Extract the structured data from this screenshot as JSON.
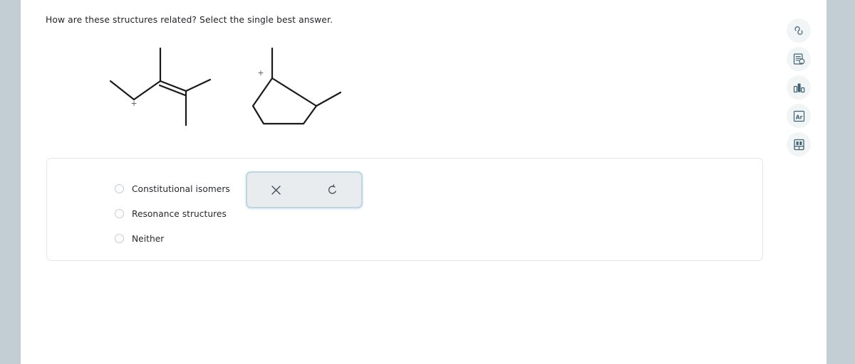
{
  "page": {
    "background_color": "#c3ced4",
    "sheet_color": "#ffffff"
  },
  "prompt": {
    "text": "How are these structures related? Select the single best answer."
  },
  "structures": {
    "caption": "two skeletal carbocation structures shown side by side",
    "items": [
      {
        "name": "structure-1",
        "description": "open-chain skeletal structure with a carbon-carbon double bond, a cationic CH2 center marked with a plus sign, plus two methyl substituents",
        "charge_symbol": "+",
        "charge_label": "carbocation-charge-left"
      },
      {
        "name": "structure-2",
        "description": "cyclopentane ring bearing a methyl group on the cationic ring carbon marked with a plus sign and a second methyl on the adjacent ring carbon",
        "charge_symbol": "+",
        "charge_label": "carbocation-charge-right"
      }
    ]
  },
  "answer": {
    "options": [
      {
        "id": "constitutional-isomers",
        "label": "Constitutional isomers",
        "selected": false
      },
      {
        "id": "resonance-structures",
        "label": "Resonance structures",
        "selected": false
      },
      {
        "id": "neither",
        "label": "Neither",
        "selected": false
      }
    ]
  },
  "tool_panel": {
    "focus_border_color": "#bcd6e6",
    "background_color": "#e8ecef",
    "buttons": [
      {
        "id": "clear",
        "icon": "close-x-icon",
        "glyph": "✕",
        "tooltip": "Clear"
      },
      {
        "id": "undo",
        "icon": "undo-arrow-icon",
        "glyph": "↺",
        "tooltip": "Undo"
      }
    ]
  },
  "right_rail": {
    "buttons": [
      {
        "id": "infinity",
        "icon": "infinity-icon",
        "label": ""
      },
      {
        "id": "hint",
        "icon": "document-hint-icon",
        "label": ""
      },
      {
        "id": "chart",
        "icon": "bar-chart-icon",
        "label": ""
      },
      {
        "id": "element",
        "icon": "element-ar-icon",
        "label": "Ar"
      },
      {
        "id": "periodic-table",
        "icon": "periodic-table-icon",
        "label": ""
      }
    ]
  }
}
